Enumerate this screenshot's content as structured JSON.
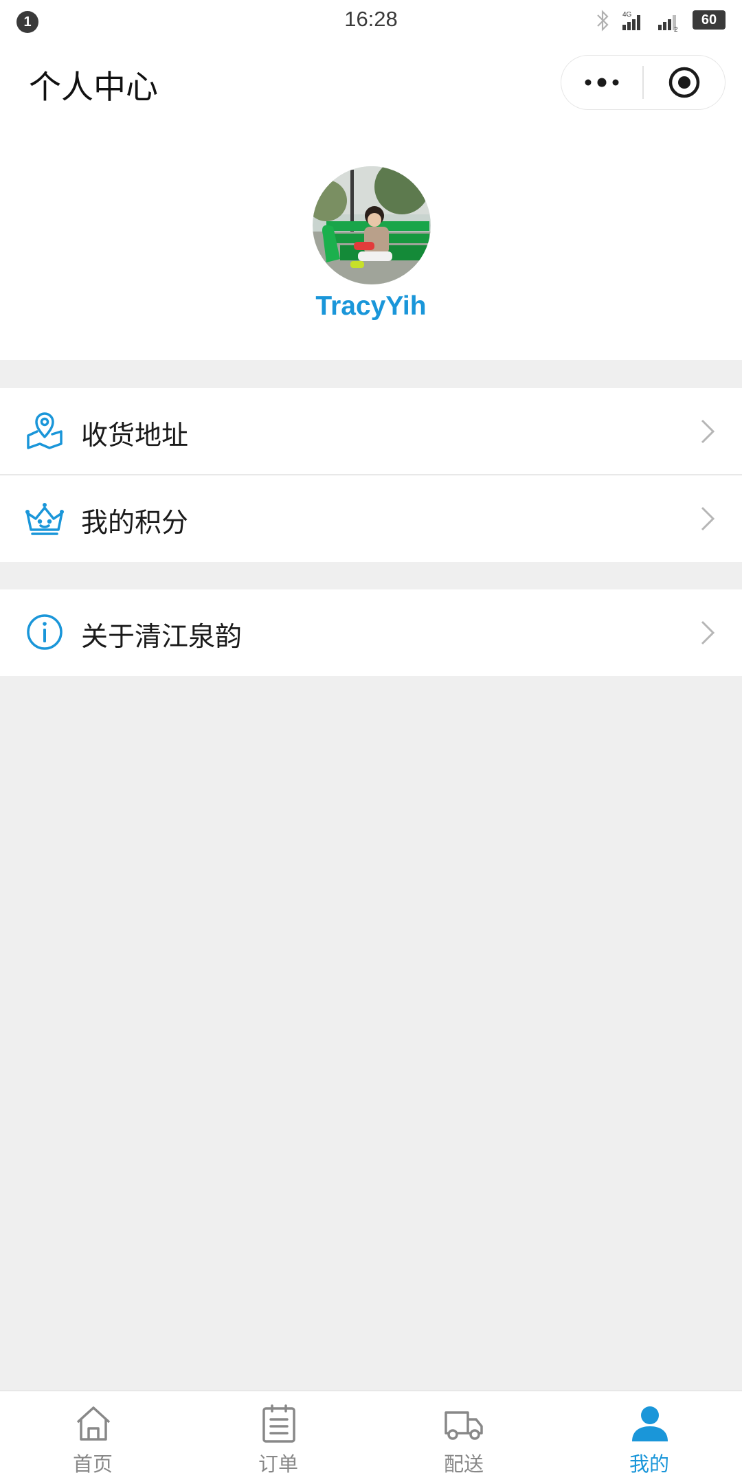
{
  "status_bar": {
    "notification_count": "1",
    "time": "16:28",
    "network_label": "4G",
    "sim_label": "2",
    "battery": "60"
  },
  "nav": {
    "title": "个人中心",
    "more_icon": "more-dots-icon",
    "close_icon": "target-circle-icon"
  },
  "profile": {
    "username": "TracyYih",
    "avatar_icon": "user-photo-avatar"
  },
  "menu": {
    "group1": [
      {
        "label": "收货地址",
        "icon": "location-map-icon"
      },
      {
        "label": "我的积分",
        "icon": "crown-icon"
      }
    ],
    "group2": [
      {
        "label": "关于清江泉韵",
        "icon": "info-icon"
      }
    ]
  },
  "tabbar": {
    "items": [
      {
        "label": "首页",
        "icon": "home-icon",
        "active": false
      },
      {
        "label": "订单",
        "icon": "order-list-icon",
        "active": false
      },
      {
        "label": "配送",
        "icon": "truck-icon",
        "active": false
      },
      {
        "label": "我的",
        "icon": "user-icon",
        "active": true
      }
    ]
  },
  "colors": {
    "accent": "#1a96d9",
    "background": "#efefef",
    "inactive": "#888888"
  }
}
